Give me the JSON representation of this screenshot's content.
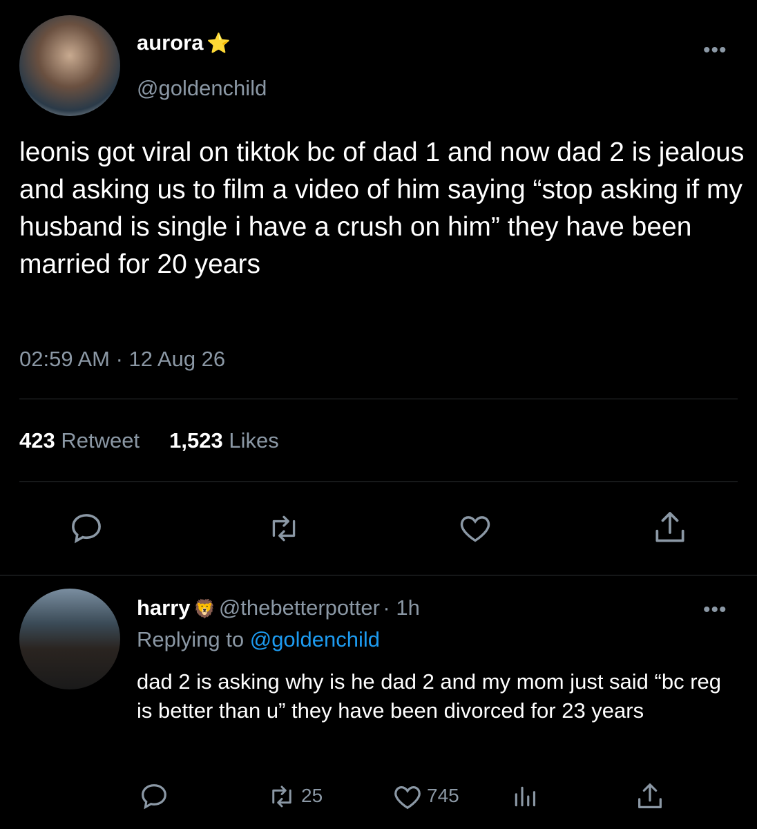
{
  "tweet": {
    "display_name": "aurora",
    "badge": "⭐",
    "handle": "@goldenchild",
    "more": "•••",
    "text": "leonis got viral on tiktok bc of dad 1 and now dad 2 is jealous and asking us to film a video of him saying “stop asking if my husband is single i have a crush on him” they have been married for 20 years",
    "timestamp": "02:59 AM · 12 Aug 26",
    "retweet_count": "423",
    "retweet_label": "Retweet",
    "like_count": "1,523",
    "like_label": "Likes",
    "actions": [
      "reply-icon",
      "retweet-icon",
      "like-icon",
      "share-icon"
    ]
  },
  "reply": {
    "display_name": "harry",
    "badge": "🦁",
    "handle": "@thebetterpotter",
    "time": "· 1h",
    "replying_prefix": "Replying to",
    "replying_to": "@goldenchild",
    "more": "•••",
    "text": "dad 2 is asking why is he dad 2 and my mom just said “bc reg is better than u” they have been divorced for 23 years",
    "retweets": "25",
    "likes": "745"
  },
  "colors": {
    "background": "#000000",
    "muted": "#8b98a5",
    "link": "#1d9bf0",
    "divider": "#2f3336"
  }
}
